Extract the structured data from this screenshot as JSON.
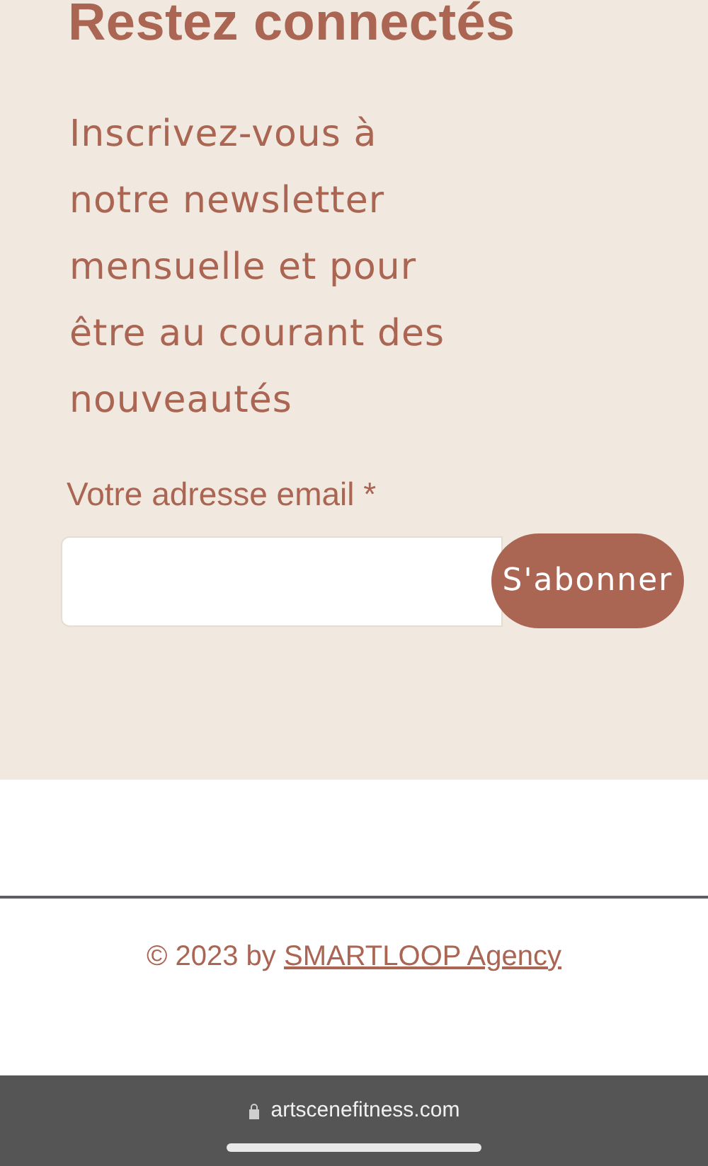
{
  "newsletter": {
    "title": "Restez connectés",
    "description": "Inscrivez-vous à\nnotre newsletter\nmensuelle et pour\nêtre au courant des\nnouveautés",
    "email_label": "Votre adresse email *",
    "subscribe_button": "S'abonner"
  },
  "footer": {
    "copyright": "© 2023 by ",
    "link": "SMARTLOOP Agency"
  },
  "browser_bar": {
    "url": "artscenefitness.com"
  }
}
